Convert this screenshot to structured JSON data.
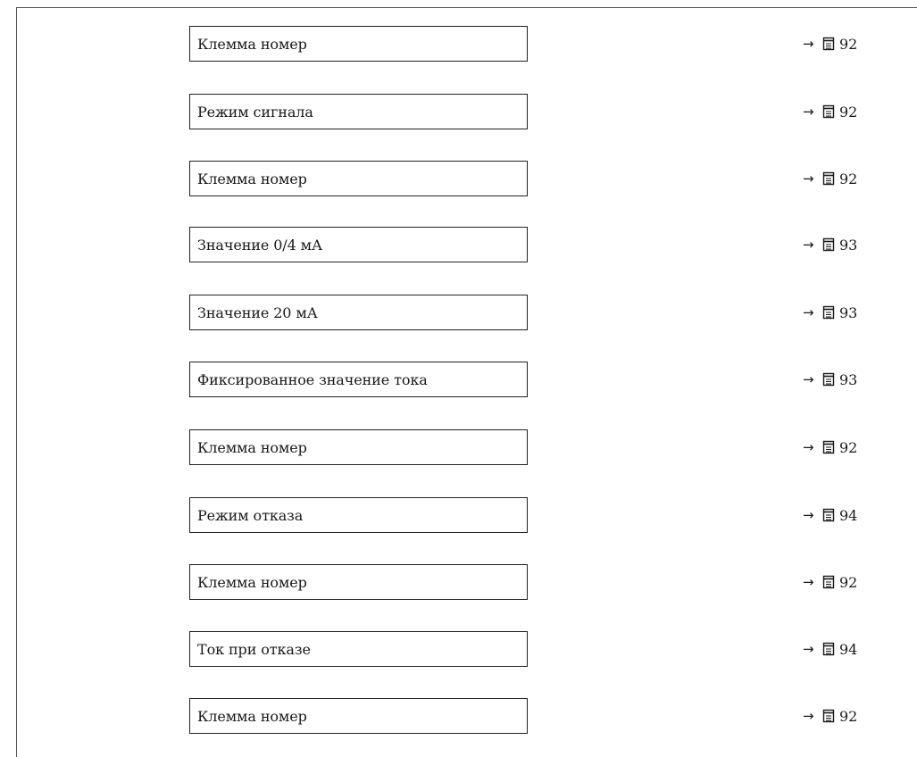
{
  "rows": [
    {
      "label": "Клемма номер",
      "ref_arrow": "→",
      "ref_page": "92"
    },
    {
      "label": "Режим сигнала",
      "ref_arrow": "→",
      "ref_page": "92"
    },
    {
      "label": "Клемма номер",
      "ref_arrow": "→",
      "ref_page": "92"
    },
    {
      "label": "Значение 0/4 мА",
      "ref_arrow": "→",
      "ref_page": "93"
    },
    {
      "label": "Значение 20 мА",
      "ref_arrow": "→",
      "ref_page": "93"
    },
    {
      "label": "Фиксированное значение тока",
      "ref_arrow": "→",
      "ref_page": "93"
    },
    {
      "label": "Клемма номер",
      "ref_arrow": "→",
      "ref_page": "92"
    },
    {
      "label": "Режим отказа",
      "ref_arrow": "→",
      "ref_page": "94"
    },
    {
      "label": "Клемма номер",
      "ref_arrow": "→",
      "ref_page": "92"
    },
    {
      "label": "Ток при отказе",
      "ref_arrow": "→",
      "ref_page": "94"
    },
    {
      "label": "Клемма номер",
      "ref_arrow": "→",
      "ref_page": "92"
    }
  ],
  "icons": {
    "page_reference": "document-page-icon"
  },
  "colors": {
    "text": "#1a1a1a",
    "border": "#222222",
    "frame": "#555555"
  }
}
